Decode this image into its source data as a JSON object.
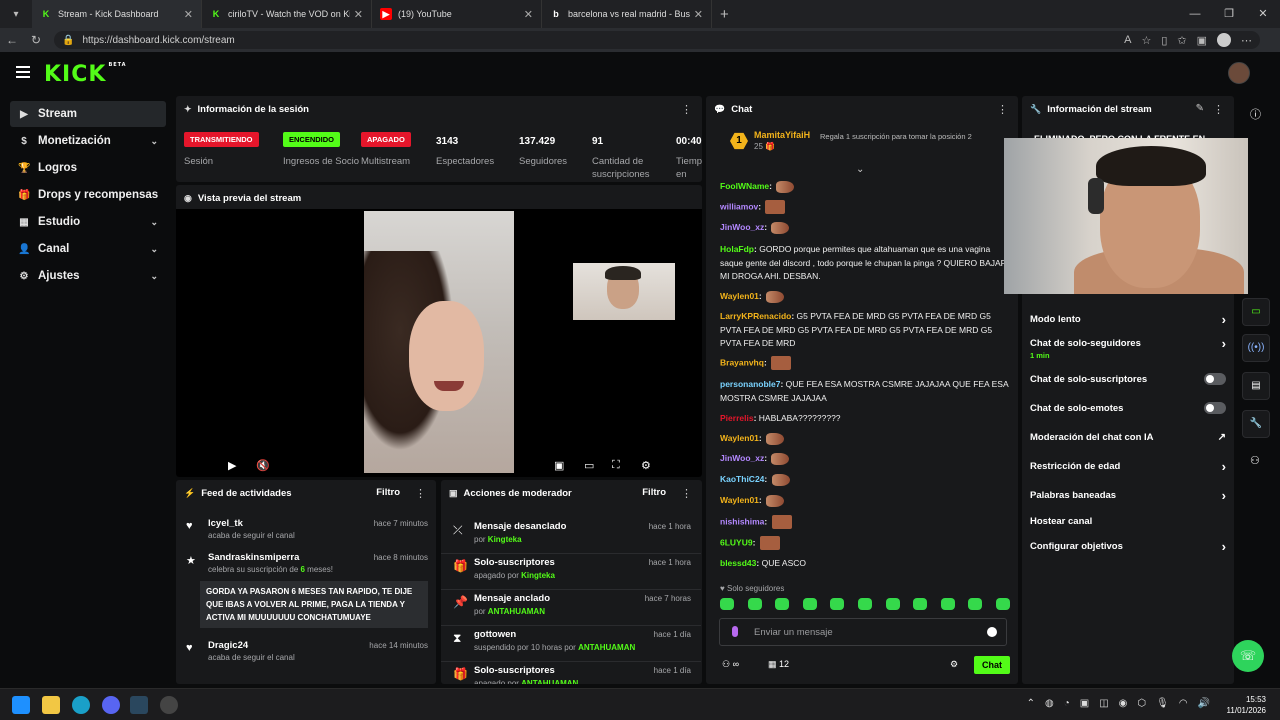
{
  "browser": {
    "tabs": [
      {
        "label": "Stream - Kick Dashboard",
        "active": true,
        "icon": "kick-icon",
        "color": "#53fc18"
      },
      {
        "label": "ciriloTV - Watch the VOD on Kick",
        "active": false,
        "icon": "kick-icon",
        "color": "#53fc18"
      },
      {
        "label": "(19) YouTube",
        "active": false,
        "icon": "youtube-icon",
        "color": "#ff0000"
      },
      {
        "label": "barcelona vs real madrid - Buscar",
        "active": false,
        "icon": "bing-icon",
        "color": "#ffffff"
      }
    ],
    "url": "https://dashboard.kick.com/stream"
  },
  "header": {
    "logo": "KICK",
    "logo_tag": "BETA"
  },
  "sidebar": {
    "items": [
      {
        "label": "Stream",
        "icon": "stream-icon",
        "active": true,
        "chevron": false
      },
      {
        "label": "Monetización",
        "icon": "money-icon",
        "active": false,
        "chevron": true
      },
      {
        "label": "Logros",
        "icon": "trophy-icon",
        "active": false,
        "chevron": false
      },
      {
        "label": "Drops y recompensas",
        "icon": "gift-icon",
        "active": false,
        "chevron": false
      },
      {
        "label": "Estudio",
        "icon": "studio-icon",
        "active": false,
        "chevron": true
      },
      {
        "label": "Canal",
        "icon": "user-icon",
        "active": false,
        "chevron": true
      },
      {
        "label": "Ajustes",
        "icon": "gear-icon",
        "active": false,
        "chevron": true
      }
    ]
  },
  "session": {
    "title": "Información de la sesión",
    "stats": [
      {
        "badge": "TRANSMITIENDO",
        "badge_color": "red",
        "label": "Sesión"
      },
      {
        "badge": "ENCENDIDO",
        "badge_color": "green",
        "label": "Ingresos de Socio"
      },
      {
        "badge": "APAGADO",
        "badge_color": "red",
        "label": "Multistream"
      },
      {
        "value": "3143",
        "label": "Espectadores"
      },
      {
        "value": "137.429",
        "label": "Seguidores"
      },
      {
        "value": "91",
        "label": "Cantidad de suscripciones"
      },
      {
        "value": "00:40",
        "label": "Tiempo en vivo"
      }
    ]
  },
  "preview": {
    "title": "Vista previa del stream"
  },
  "feed": {
    "title": "Feed de actividades",
    "filter": "Filtro",
    "items": [
      {
        "icon": "heart-icon",
        "name": "lcyel_tk",
        "desc": "acaba de seguir el canal",
        "time": "hace 7 minutos"
      },
      {
        "icon": "star-icon",
        "name": "Sandraskinsmiperra",
        "desc_pre": "celebra su suscripción de ",
        "desc_num": "6",
        "desc_post": " meses!",
        "time": "hace 8 minutos",
        "message": "GORDA YA PASARON 6 MESES TAN RAPIDO, TE DIJE QUE IBAS A VOLVER AL PRIME, PAGA LA TIENDA Y ACTIVA MI MUUUUUUU CONCHATUMUAYE"
      },
      {
        "icon": "heart-icon",
        "name": "Dragic24",
        "desc": "acaba de seguir el canal",
        "time": "hace 14 minutos"
      }
    ]
  },
  "mod": {
    "title": "Acciones de moderador",
    "filter": "Filtro",
    "items": [
      {
        "icon": "unpin-icon",
        "title": "Mensaje desanclado",
        "pre": "por ",
        "user": "Kingteka",
        "time": "hace 1 hora"
      },
      {
        "icon": "gift-icon",
        "title": "Solo-suscriptores",
        "pre": "apagado por ",
        "user": "Kingteka",
        "time": "hace 1 hora"
      },
      {
        "icon": "pin-icon",
        "title": "Mensaje anclado",
        "pre": "por ",
        "user": "ANTAHUAMAN",
        "time": "hace 7 horas"
      },
      {
        "icon": "hourglass-icon",
        "title": "gottowen",
        "pre": "suspendido por 10 horas por ",
        "user": "ANTAHUAMAN",
        "time": "hace 1 día"
      },
      {
        "icon": "gift-icon",
        "title": "Solo-suscriptores",
        "pre": "apagado por ",
        "user": "ANTAHUAMAN",
        "time": "hace 1 día"
      }
    ]
  },
  "chat": {
    "title": "Chat",
    "pinned": {
      "rank": "1",
      "user": "MamitaYifaiH",
      "count": "25",
      "text": "Regala 1 suscripción para tomar la posición 2"
    },
    "lines": [
      {
        "user": "FoolWName",
        "color": "#53fc18",
        "text": "",
        "emotes": [
          "hand"
        ]
      },
      {
        "user": "williamov",
        "color": "#b388ff",
        "text": "",
        "emotes": [
          "face"
        ]
      },
      {
        "user": "JinWoo_xz",
        "color": "#b388ff",
        "text": "",
        "emotes": [
          "hand"
        ]
      },
      {
        "user": "HolaFdp",
        "color": "#53fc18",
        "text": "GORDO porque permites que altahuaman que es una vagina saque gente del discord , todo porque le chupan la pinga ? QUIERO BAJAR MI DROGA AHI. DESBAN.",
        "emotes": []
      },
      {
        "user": "Waylen01",
        "color": "#f2b31b",
        "text": "",
        "emotes": [
          "hand"
        ]
      },
      {
        "user": "LarryKPRenacido",
        "color": "#f2b31b",
        "text": "G5 PVTA FEA DE MRD G5 PVTA FEA DE MRD G5 PVTA FEA DE MRD G5 PVTA FEA DE MRD G5 PVTA FEA DE MRD G5 PVTA FEA DE MRD",
        "emotes": []
      },
      {
        "user": "Brayanvhq",
        "color": "#f2b31b",
        "text": "",
        "emotes": [
          "face"
        ]
      },
      {
        "user": "personanoble7",
        "color": "#7ad3ff",
        "text": "QUE FEA ESA MOSTRA CSMRE JAJAJAA QUE FEA ESA MOSTRA CSMRE JAJAJAA",
        "emotes": []
      },
      {
        "user": "Pierrelis",
        "color": "#e5162b",
        "text": "HABLABA?????????",
        "emotes": []
      },
      {
        "user": "Waylen01",
        "color": "#f2b31b",
        "text": "",
        "emotes": [
          "hand"
        ]
      },
      {
        "user": "JinWoo_xz",
        "color": "#b388ff",
        "text": "",
        "emotes": [
          "hand"
        ]
      },
      {
        "user": "KaoThiC24",
        "color": "#7ad3ff",
        "text": "",
        "emotes": [
          "hand"
        ]
      },
      {
        "user": "Waylen01",
        "color": "#f2b31b",
        "text": "",
        "emotes": [
          "hand"
        ]
      },
      {
        "user": "nishishima",
        "color": "#b388ff",
        "text": "",
        "emotes": [
          "face"
        ]
      },
      {
        "user": "6LUYU9",
        "color": "#53fc18",
        "text": "",
        "emotes": [
          "face"
        ]
      },
      {
        "user": "blessd43",
        "color": "#53fc18",
        "text": "QUE ASCO",
        "emotes": []
      }
    ],
    "followers_only": "Solo seguidores",
    "input_placeholder": "Enviar un mensaje",
    "viewers": "12",
    "send": "Chat"
  },
  "stream_info": {
    "title": "Información del stream",
    "stream_title": "ELIMINADO, PERO CON LA FRENTE EN",
    "items": [
      {
        "label": "Modo lento",
        "control": "arrow"
      },
      {
        "label": "Chat de solo-seguidores",
        "sub": "1 min",
        "control": "arrow"
      },
      {
        "label": "Chat de solo-suscriptores",
        "control": "toggle"
      },
      {
        "label": "Chat de solo-emotes",
        "control": "toggle"
      },
      {
        "label": "Moderación del chat con IA",
        "control": "external"
      },
      {
        "label": "Restricción de edad",
        "control": "arrow"
      },
      {
        "label": "Palabras baneadas",
        "control": "arrow"
      },
      {
        "label": "Hostear canal",
        "control": "none"
      },
      {
        "label": "Configurar objetivos",
        "control": "arrow"
      }
    ]
  },
  "taskbar": {
    "time": "15:53",
    "date": "11/01/2026"
  },
  "colors": {
    "accent": "#53fc18",
    "live_red": "#e5162b",
    "panel": "#18191b"
  }
}
